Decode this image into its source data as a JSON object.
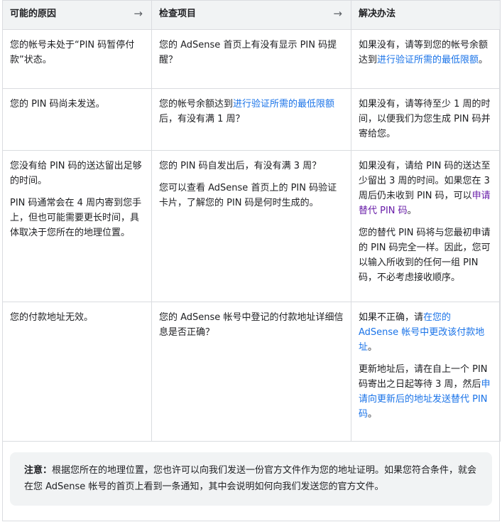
{
  "headers": {
    "col1": "可能的原因",
    "col2": "检查项目",
    "col3": "解决办法",
    "arrow_glyph": "→"
  },
  "rows": [
    {
      "cause": [
        "您的帐号未处于“PIN 码暂停付款”状态。"
      ],
      "check": {
        "prefix": "您的 AdSense 首页上有没有显示 PIN 码提醒？",
        "link": "",
        "suffix": ""
      },
      "fix": [
        {
          "prefix": "如果没有，请等到您的帐号余额达到",
          "link": "进行验证所需的最低限额",
          "suffix": "。",
          "visited": false
        }
      ]
    },
    {
      "cause": [
        "您的 PIN 码尚未发送。"
      ],
      "check": {
        "prefix": "您的帐号余额达到",
        "link": "进行验证所需的最低限额",
        "suffix": "后，有没有满 1 周？"
      },
      "fix": [
        {
          "prefix": "如果没有，请等待至少 1 周的时间，以便我们为您生成 PIN 码并寄给您。",
          "link": "",
          "suffix": "",
          "visited": false
        }
      ]
    },
    {
      "cause": [
        "您没有给 PIN 码的送达留出足够的时间。",
        "PIN 码通常会在 4 周内寄到您手上，但也可能需要更长时间，具体取决于您所在的地理位置。"
      ],
      "check_paras": [
        "您的 PIN 码自发出后，有没有满 3 周？",
        "您可以查看 AdSense 首页上的 PIN 码验证卡片，了解您的 PIN 码是何时生成的。"
      ],
      "fix": [
        {
          "prefix": "如果没有，请给 PIN 码的送达至少留出 3 周的时间。如果您在 3 周后仍未收到 PIN 码，可以",
          "link": "申请替代 PIN 码",
          "suffix": "。",
          "visited": true
        },
        {
          "prefix": "您的替代 PIN 码将与您最初申请的 PIN 码完全一样。因此，您可以输入所收到的任何一组 PIN 码，不必考虑接收顺序。",
          "link": "",
          "suffix": "",
          "visited": false
        }
      ]
    },
    {
      "cause": [
        "您的付款地址无效。"
      ],
      "check": {
        "prefix": "您的 AdSense 帐号中登记的付款地址详细信息是否正确？",
        "link": "",
        "suffix": ""
      },
      "fix": [
        {
          "prefix": "如果不正确，请",
          "link": "在您的 AdSense 帐号中更改该付款地址",
          "suffix": "。",
          "visited": false
        },
        {
          "prefix": "更新地址后，请在自上一个 PIN 码寄出之日起等待 3 周，然后",
          "link": "申请向更新后的地址发送替代 PIN 码",
          "suffix": "。",
          "visited": false
        }
      ]
    }
  ],
  "note": {
    "label": "注意：",
    "text": "根据您所在的地理位置，您也许可以向我们发送一份官方文件作为您的地址证明。如果您符合条件，就会在您 AdSense 帐号的首页上看到一条通知，其中会说明如何向我们发送您的官方文件。"
  },
  "colors": {
    "link": "#1a73e8",
    "visited_link": "#681da8",
    "header_bg": "#f1f3f4",
    "border": "#dadce0",
    "text": "#202124"
  }
}
